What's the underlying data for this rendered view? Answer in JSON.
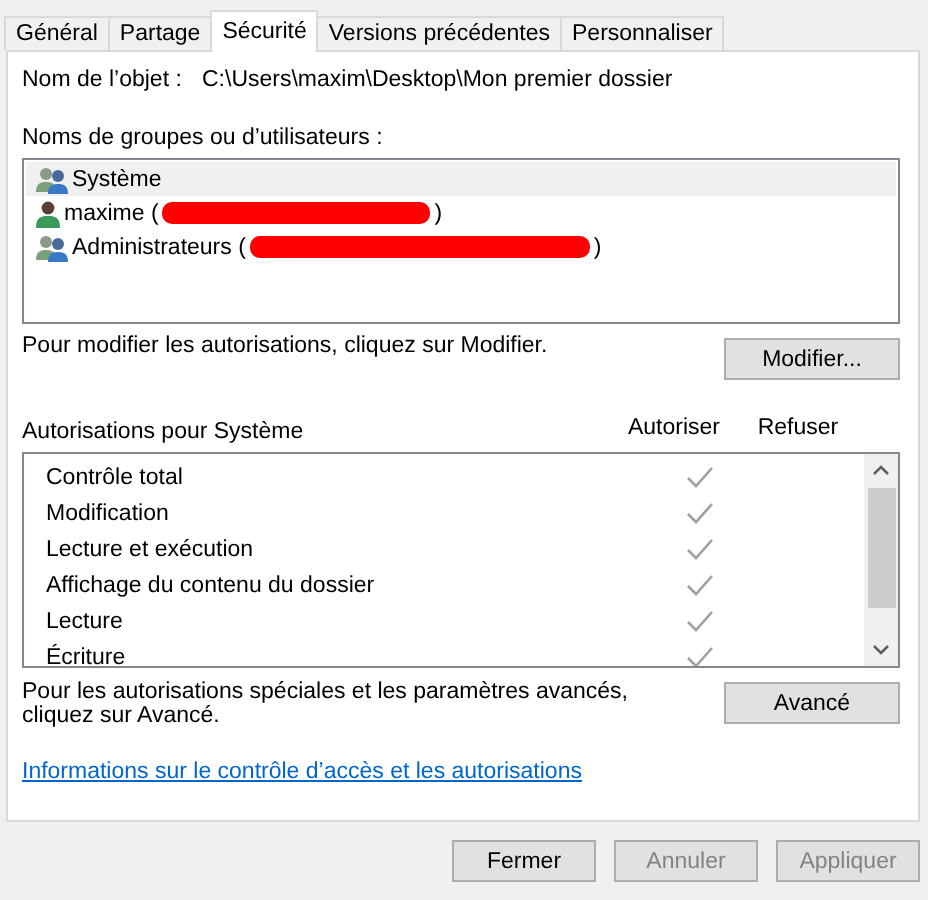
{
  "tabs": [
    {
      "label": "Général",
      "selected": false
    },
    {
      "label": "Partage",
      "selected": false
    },
    {
      "label": "Sécurité",
      "selected": true
    },
    {
      "label": "Versions précédentes",
      "selected": false
    },
    {
      "label": "Personnaliser",
      "selected": false
    }
  ],
  "object": {
    "label": "Nom de l’objet :",
    "value": "C:\\Users\\maxim\\Desktop\\Mon premier dossier"
  },
  "groups": {
    "label": "Noms de groupes ou d’utilisateurs :",
    "items": [
      {
        "kind": "group",
        "name": "Système",
        "selected": true
      },
      {
        "kind": "user",
        "name": "maxime (",
        "redacted": true,
        "suffix": ")",
        "selected": false
      },
      {
        "kind": "group",
        "name": "Administrateurs (",
        "redacted": true,
        "suffix": ")",
        "selected": false
      }
    ]
  },
  "edit_hint": "Pour modifier les autorisations, cliquez sur Modifier.",
  "edit_button": "Modifier...",
  "permissions": {
    "title": "Autorisations pour Système",
    "columns": [
      "Autoriser",
      "Refuser"
    ],
    "rows": [
      {
        "name": "Contrôle total",
        "allow": true
      },
      {
        "name": "Modification",
        "allow": true
      },
      {
        "name": "Lecture et exécution",
        "allow": true
      },
      {
        "name": "Affichage du contenu du dossier",
        "allow": true
      },
      {
        "name": "Lecture",
        "allow": true
      },
      {
        "name": "Écriture",
        "allow": true
      }
    ]
  },
  "advanced_hint": "Pour les autorisations spéciales et les paramètres avancés, cliquez sur Avancé.",
  "advanced_button": "Avancé",
  "link": "Informations sur le contrôle d’accès et les autorisations",
  "buttons": [
    {
      "label": "Fermer",
      "disabled": false
    },
    {
      "label": "Annuler",
      "disabled": true
    },
    {
      "label": "Appliquer",
      "disabled": true
    }
  ]
}
